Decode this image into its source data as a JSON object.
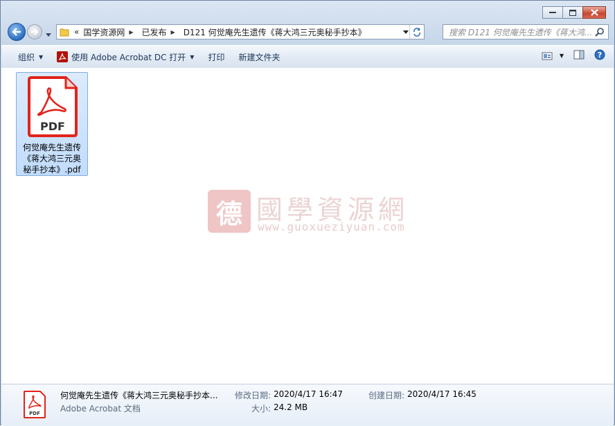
{
  "window": {
    "caption_buttons": [
      "minimize",
      "maximize",
      "close"
    ]
  },
  "navigation": {
    "breadcrumb_overflow": "«",
    "breadcrumb": [
      "国学资源网",
      "已发布",
      "D121 何觉庵先生遗传《蒋大鸿三元奥秘手抄本》"
    ]
  },
  "search": {
    "placeholder": "搜索 D121 何觉庵先生遗传《蒋大鸿..."
  },
  "toolbar": {
    "organize": "组织",
    "open_with": "使用 Adobe Acrobat DC 打开",
    "print": "打印",
    "new_folder": "新建文件夹"
  },
  "file": {
    "icon_label": "PDF",
    "name_line1": "何觉庵先生遗传",
    "name_line2": "《蒋大鸿三元奥",
    "name_line3": "秘手抄本》.pdf"
  },
  "watermark": {
    "logo_char": "德",
    "title": "國學資源網",
    "url": "www.guoxueziyuan.com"
  },
  "details": {
    "name": "何觉庵先生遗传《蒋大鸿三元奥秘手抄本...",
    "type": "Adobe Acrobat 文档",
    "modified_label": "修改日期:",
    "modified_value": "2020/4/17 16:47",
    "size_label": "大小:",
    "size_value": "24.2 MB",
    "created_label": "创建日期:",
    "created_value": "2020/4/17 16:45",
    "icon_label": "PDF"
  },
  "colors": {
    "pdf_red": "#e2231a",
    "selection": "#c1dcfc",
    "toolbar_text": "#1e395b"
  }
}
